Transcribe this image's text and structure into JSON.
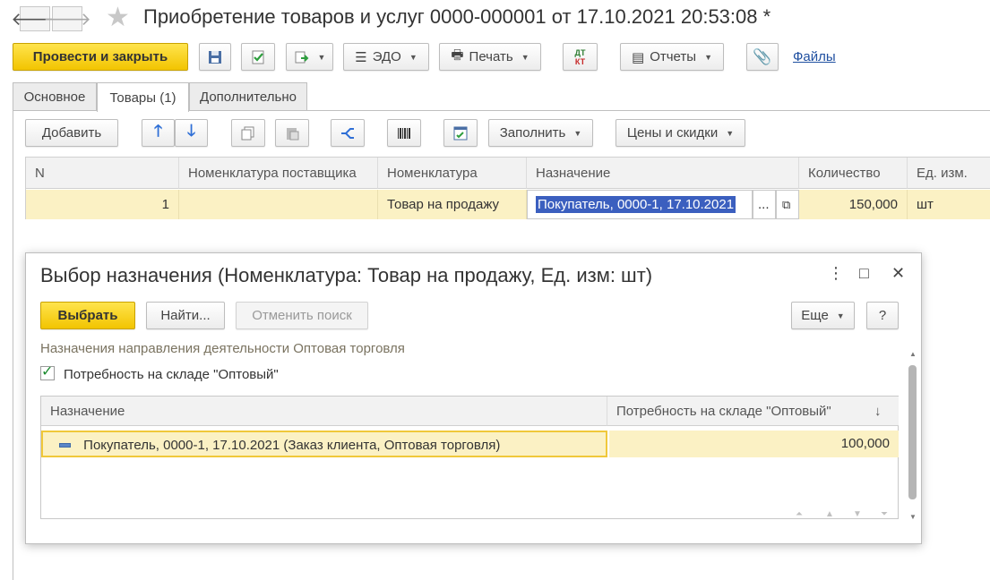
{
  "window": {
    "title": "Приобретение товаров и услуг 0000-000001 от 17.10.2021 20:53:08 *",
    "back_icon": "arrow-left-icon",
    "forward_icon": "arrow-right-icon",
    "favorite_icon": "star-icon"
  },
  "toolbar": {
    "post_close_label": "Провести и закрыть",
    "edo_label": "ЭДО",
    "print_label": "Печать",
    "dtkt_label_top": "ДТ",
    "dtkt_label_bottom": "КТ",
    "reports_label": "Отчеты",
    "files_label": "Файлы"
  },
  "tabs": [
    {
      "label": "Основное"
    },
    {
      "label": "Товары (1)"
    },
    {
      "label": "Дополнительно"
    }
  ],
  "goods_toolbar": {
    "add_label": "Добавить",
    "fill_label": "Заполнить",
    "prices_label": "Цены и скидки"
  },
  "goods_table": {
    "columns": [
      "N",
      "Номенклатура поставщика",
      "Номенклатура",
      "Назначение",
      "Количество",
      "Ед. изм."
    ],
    "rows": [
      {
        "n": "1",
        "supplier_item": "",
        "item": "Товар на продажу",
        "purpose": "Покупатель, 0000-1, 17.10.2021",
        "select_btn": "...",
        "qty": "150,000",
        "unit": "шт"
      }
    ]
  },
  "dialog": {
    "title": "Выбор назначения (Номенклатура: Товар на продажу, Ед. изм: шт)",
    "more_icon": "⋮",
    "maximize_icon": "□",
    "close_icon": "✕",
    "select_label": "Выбрать",
    "find_label": "Найти...",
    "cancel_search_label": "Отменить поиск",
    "more_label": "Еще",
    "help_label": "?",
    "group_label": "Назначения направления деятельности Оптовая торговля",
    "checkbox_checked": true,
    "checkbox_label": "Потребность на складе \"Оптовый\"",
    "table": {
      "columns": [
        "Назначение",
        "Потребность на складе \"Оптовый\""
      ],
      "sort_indicator": "↓",
      "rows": [
        {
          "purpose": "Покупатель, 0000-1, 17.10.2021 (Заказ клиента, Оптовая торговля)",
          "need": "100,000"
        }
      ]
    }
  }
}
